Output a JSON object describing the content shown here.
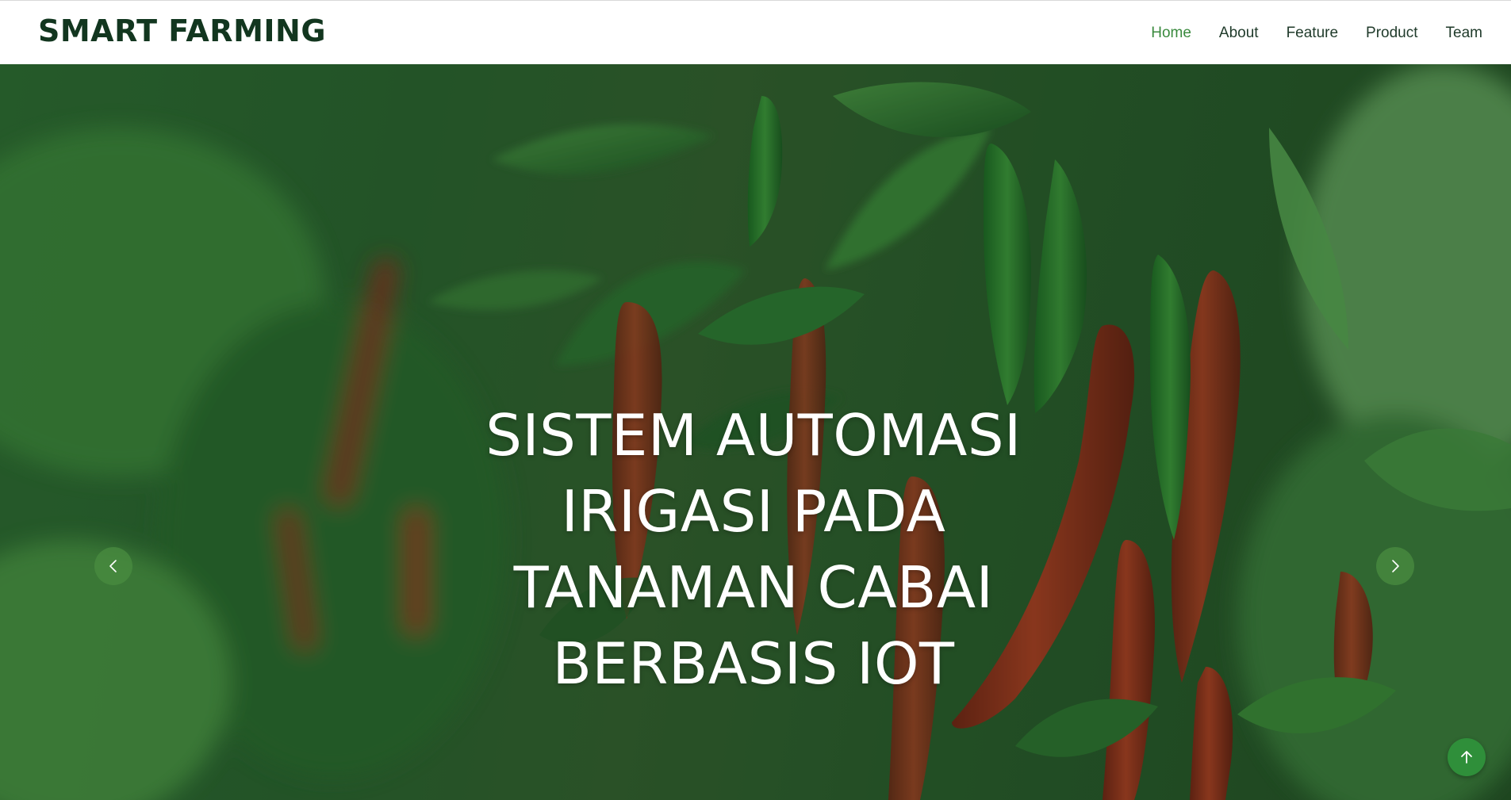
{
  "header": {
    "logo": "SMART FARMING",
    "nav": [
      "Home",
      "About",
      "Feature",
      "Product",
      "Team"
    ],
    "active_nav": "Home"
  },
  "hero": {
    "title_lines": [
      "SISTEM AUTOMASI",
      "IRIGASI PADA",
      "TANAMAN CABAI",
      "BERBASIS IOT"
    ]
  },
  "icons": {
    "prev": "chevron-left-icon",
    "next": "chevron-right-icon",
    "back_to_top": "arrow-up-icon"
  },
  "colors": {
    "brand": "#12361f",
    "active_nav": "#3a8a3e",
    "button_green": "#2f8f3a",
    "chili_red": "#a8321c",
    "leaf_green": "#2f7a34"
  }
}
